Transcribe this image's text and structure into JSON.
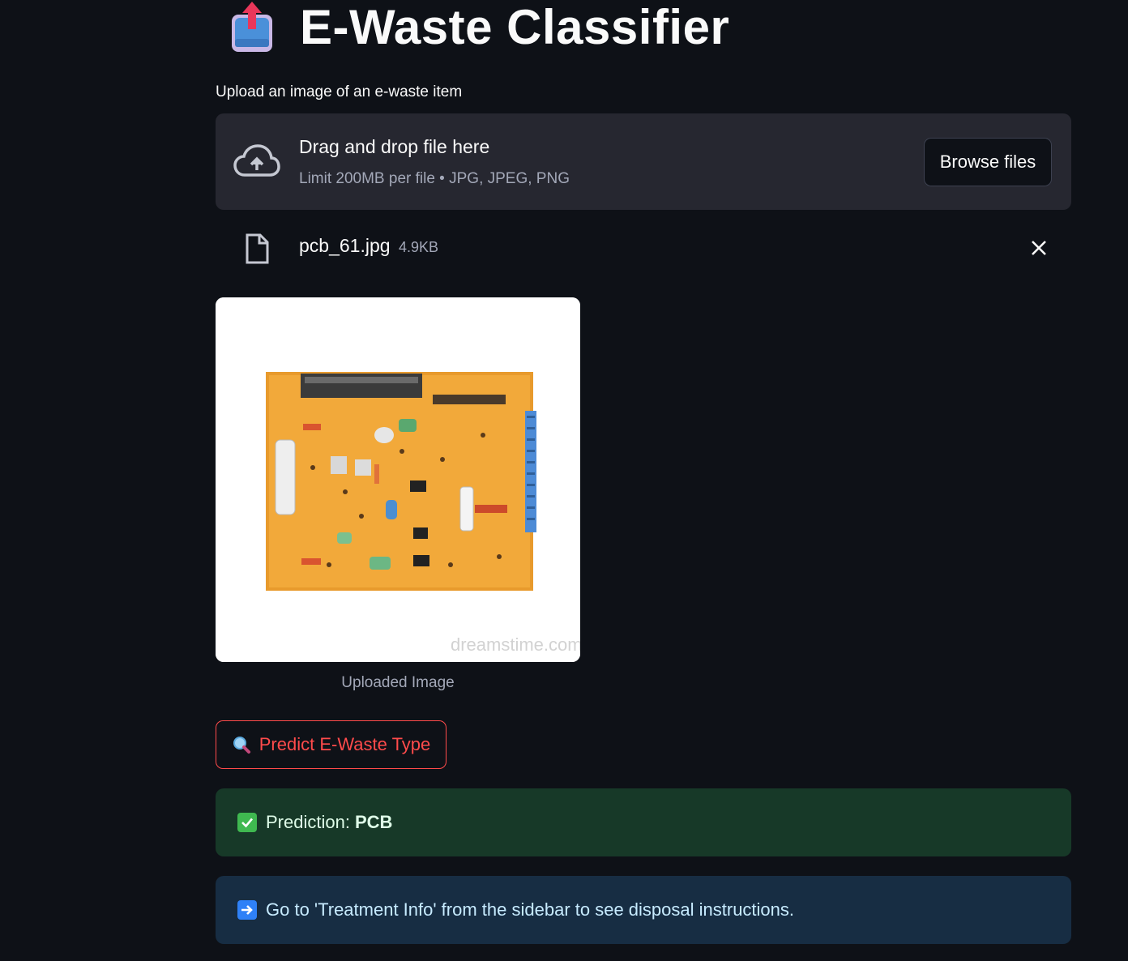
{
  "app": {
    "title": "E-Waste Classifier",
    "title_icon": "outbox-tray-icon"
  },
  "uploader": {
    "label": "Upload an image of an e-waste item",
    "drop_text": "Drag and drop file here",
    "limit_text": "Limit 200MB per file • JPG, JPEG, PNG",
    "browse_label": "Browse files",
    "icon": "cloud-upload-icon"
  },
  "uploaded_file": {
    "name": "pcb_61.jpg",
    "size": "4.9KB",
    "icon": "file-icon",
    "remove_icon": "close-icon"
  },
  "image": {
    "caption": "Uploaded Image",
    "watermark": "dreamstime.com"
  },
  "predict_button": {
    "label": "Predict E-Waste Type",
    "icon": "magnifying-glass-icon"
  },
  "result": {
    "prefix": "Prediction:",
    "value": "PCB",
    "icon": "check-mark-button-icon"
  },
  "info": {
    "text": "Go to 'Treatment Info' from the sidebar to see disposal instructions.",
    "icon": "right-arrow-icon"
  },
  "colors": {
    "background": "#0e1117",
    "dropzone": "#262730",
    "accent": "#ff4b4b",
    "success_bg": "#173928",
    "info_bg": "#172d43"
  }
}
